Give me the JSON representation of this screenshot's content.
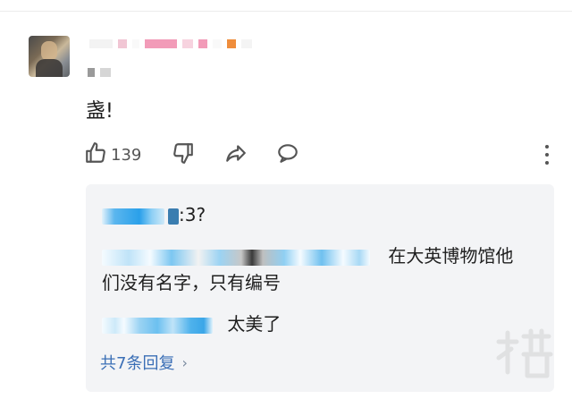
{
  "comment": {
    "text": "盏!",
    "actions": {
      "like_count": "139"
    }
  },
  "replies": {
    "items": [
      {
        "text": ":3?"
      },
      {
        "text": "在大英博物馆他",
        "text_line2": "们没有名字，只有编号"
      },
      {
        "text": "太美了"
      }
    ],
    "view_all": "共7条回复",
    "view_all_chevron": "›"
  },
  "colors": {
    "link": "#3b6fb6",
    "reply_bg": "#f3f4f6",
    "icon": "#555555"
  },
  "icons": [
    "thumbs-up-icon",
    "thumbs-down-icon",
    "share-icon",
    "comment-icon",
    "more-vertical-icon",
    "chevron-right-icon"
  ]
}
